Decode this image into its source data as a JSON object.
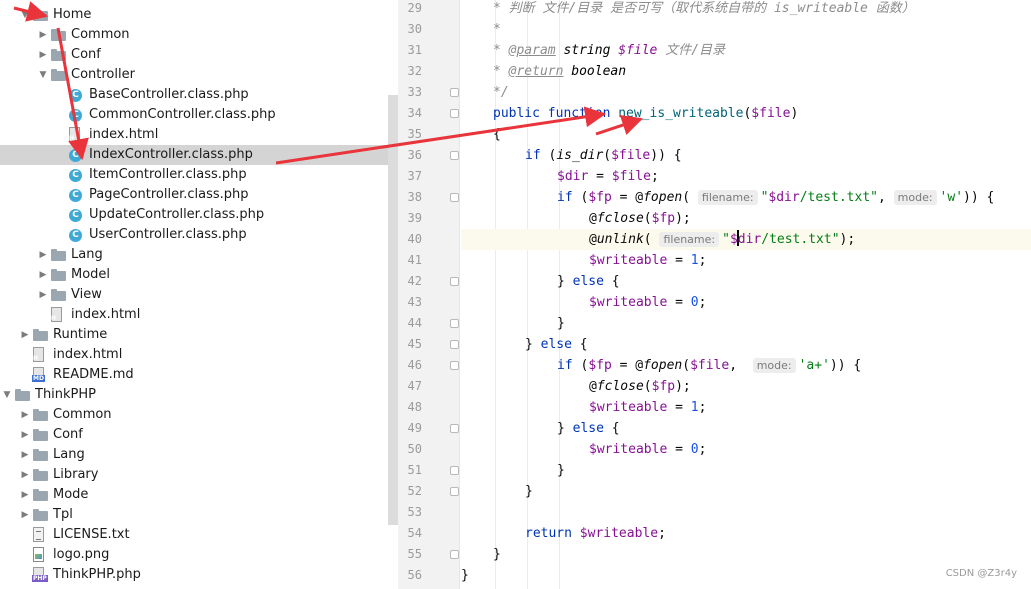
{
  "project_tree": {
    "rows": [
      {
        "label": "Home",
        "depth": 2,
        "arrow": "open",
        "icon": "folder"
      },
      {
        "label": "Common",
        "depth": 3,
        "arrow": "closed",
        "icon": "folder"
      },
      {
        "label": "Conf",
        "depth": 3,
        "arrow": "closed",
        "icon": "folder"
      },
      {
        "label": "Controller",
        "depth": 3,
        "arrow": "open",
        "icon": "folder"
      },
      {
        "label": "BaseController.class.php",
        "depth": 4,
        "arrow": "none",
        "icon": "class"
      },
      {
        "label": "CommonController.class.php",
        "depth": 4,
        "arrow": "none",
        "icon": "class"
      },
      {
        "label": "index.html",
        "depth": 4,
        "arrow": "none",
        "icon": "html"
      },
      {
        "label": "IndexController.class.php",
        "depth": 4,
        "arrow": "none",
        "icon": "class",
        "selected": true
      },
      {
        "label": "ItemController.class.php",
        "depth": 4,
        "arrow": "none",
        "icon": "class"
      },
      {
        "label": "PageController.class.php",
        "depth": 4,
        "arrow": "none",
        "icon": "class"
      },
      {
        "label": "UpdateController.class.php",
        "depth": 4,
        "arrow": "none",
        "icon": "class"
      },
      {
        "label": "UserController.class.php",
        "depth": 4,
        "arrow": "none",
        "icon": "class"
      },
      {
        "label": "Lang",
        "depth": 3,
        "arrow": "closed",
        "icon": "folder"
      },
      {
        "label": "Model",
        "depth": 3,
        "arrow": "closed",
        "icon": "folder"
      },
      {
        "label": "View",
        "depth": 3,
        "arrow": "closed",
        "icon": "folder"
      },
      {
        "label": "index.html",
        "depth": 3,
        "arrow": "none",
        "icon": "html"
      },
      {
        "label": "Runtime",
        "depth": 2,
        "arrow": "closed",
        "icon": "folder"
      },
      {
        "label": "index.html",
        "depth": 2,
        "arrow": "none",
        "icon": "html"
      },
      {
        "label": "README.md",
        "depth": 2,
        "arrow": "none",
        "icon": "md"
      },
      {
        "label": "ThinkPHP",
        "depth": 1,
        "arrow": "open",
        "icon": "folder"
      },
      {
        "label": "Common",
        "depth": 2,
        "arrow": "closed",
        "icon": "folder"
      },
      {
        "label": "Conf",
        "depth": 2,
        "arrow": "closed",
        "icon": "folder"
      },
      {
        "label": "Lang",
        "depth": 2,
        "arrow": "closed",
        "icon": "folder"
      },
      {
        "label": "Library",
        "depth": 2,
        "arrow": "closed",
        "icon": "folder"
      },
      {
        "label": "Mode",
        "depth": 2,
        "arrow": "closed",
        "icon": "folder"
      },
      {
        "label": "Tpl",
        "depth": 2,
        "arrow": "closed",
        "icon": "folder"
      },
      {
        "label": "LICENSE.txt",
        "depth": 2,
        "arrow": "none",
        "icon": "txt"
      },
      {
        "label": "logo.png",
        "depth": 2,
        "arrow": "none",
        "icon": "png"
      },
      {
        "label": "ThinkPHP.php",
        "depth": 2,
        "arrow": "none",
        "icon": "php"
      }
    ]
  },
  "icon_tags": {
    "html": "H",
    "md": "MD",
    "php": "PHP"
  },
  "editor": {
    "current_line": 40,
    "lines": [
      {
        "n": "29",
        "indent": 1,
        "tokens": [
          [
            "cm",
            "* 判断 文件/目录 是否可写（取代系统自带的 is_writeable 函数）"
          ]
        ]
      },
      {
        "n": "30",
        "indent": 1,
        "tokens": [
          [
            "cm",
            "*"
          ]
        ]
      },
      {
        "n": "31",
        "indent": 1,
        "tokens": [
          [
            "cm",
            "* "
          ],
          [
            "tag",
            "@param"
          ],
          [
            "cm",
            " "
          ],
          [
            "dty",
            "string"
          ],
          [
            "cm",
            " "
          ],
          [
            "dvar",
            "$file"
          ],
          [
            "cm",
            " 文件/目录"
          ]
        ]
      },
      {
        "n": "32",
        "indent": 1,
        "tokens": [
          [
            "cm",
            "* "
          ],
          [
            "tag",
            "@return"
          ],
          [
            "cm",
            " "
          ],
          [
            "dty",
            "boolean"
          ]
        ]
      },
      {
        "n": "33",
        "indent": 1,
        "tokens": [
          [
            "cm",
            "*/"
          ]
        ]
      },
      {
        "n": "34",
        "indent": 1,
        "tokens": [
          [
            "kw",
            "public function "
          ],
          [
            "fn",
            "new_is_writeable"
          ],
          [
            "p",
            "("
          ],
          [
            "var",
            "$file"
          ],
          [
            "p",
            ")"
          ]
        ]
      },
      {
        "n": "35",
        "indent": 1,
        "tokens": [
          [
            "p",
            "{"
          ]
        ]
      },
      {
        "n": "36",
        "indent": 2,
        "tokens": [
          [
            "kw",
            "if "
          ],
          [
            "p",
            "("
          ],
          [
            "ifn",
            "is_dir"
          ],
          [
            "p",
            "("
          ],
          [
            "var",
            "$file"
          ],
          [
            "p",
            ")) {"
          ]
        ]
      },
      {
        "n": "37",
        "indent": 3,
        "tokens": [
          [
            "var",
            "$dir"
          ],
          [
            "p",
            " = "
          ],
          [
            "var",
            "$file"
          ],
          [
            "p",
            ";"
          ]
        ]
      },
      {
        "n": "38",
        "indent": 3,
        "tokens": [
          [
            "kw",
            "if "
          ],
          [
            "p",
            "("
          ],
          [
            "var",
            "$fp"
          ],
          [
            "p",
            " = @"
          ],
          [
            "ifn",
            "fopen"
          ],
          [
            "p",
            "( "
          ],
          [
            "hint",
            "filename:"
          ],
          [
            "str",
            "\""
          ],
          [
            "var",
            "$dir"
          ],
          [
            "str",
            "/test.txt\""
          ],
          [
            "p",
            ", "
          ],
          [
            "hint",
            "mode:"
          ],
          [
            "str",
            "'w'"
          ],
          [
            "p",
            ")) {"
          ]
        ]
      },
      {
        "n": "39",
        "indent": 4,
        "tokens": [
          [
            "p",
            "@"
          ],
          [
            "ifn",
            "fclose"
          ],
          [
            "p",
            "("
          ],
          [
            "var",
            "$fp"
          ],
          [
            "p",
            ");"
          ]
        ]
      },
      {
        "n": "40",
        "indent": 4,
        "tokens": [
          [
            "p",
            "@"
          ],
          [
            "ifn",
            "unlink"
          ],
          [
            "p",
            "( "
          ],
          [
            "hint",
            "filename:"
          ],
          [
            "str",
            "\""
          ],
          [
            "var",
            "$"
          ],
          [
            "caret",
            ""
          ],
          [
            "var",
            "dir"
          ],
          [
            "str",
            "/test.txt\""
          ],
          [
            "p",
            ");"
          ]
        ]
      },
      {
        "n": "41",
        "indent": 4,
        "tokens": [
          [
            "var",
            "$writeable"
          ],
          [
            "p",
            " = "
          ],
          [
            "num",
            "1"
          ],
          [
            "p",
            ";"
          ]
        ]
      },
      {
        "n": "42",
        "indent": 3,
        "tokens": [
          [
            "p",
            "} "
          ],
          [
            "kw",
            "else"
          ],
          [
            "p",
            " {"
          ]
        ]
      },
      {
        "n": "43",
        "indent": 4,
        "tokens": [
          [
            "var",
            "$writeable"
          ],
          [
            "p",
            " = "
          ],
          [
            "num",
            "0"
          ],
          [
            "p",
            ";"
          ]
        ]
      },
      {
        "n": "44",
        "indent": 3,
        "tokens": [
          [
            "p",
            "}"
          ]
        ]
      },
      {
        "n": "45",
        "indent": 2,
        "tokens": [
          [
            "p",
            "} "
          ],
          [
            "kw",
            "else"
          ],
          [
            "p",
            " {"
          ]
        ]
      },
      {
        "n": "46",
        "indent": 3,
        "tokens": [
          [
            "kw",
            "if "
          ],
          [
            "p",
            "("
          ],
          [
            "var",
            "$fp"
          ],
          [
            "p",
            " = @"
          ],
          [
            "ifn",
            "fopen"
          ],
          [
            "p",
            "("
          ],
          [
            "var",
            "$file"
          ],
          [
            "p",
            ",  "
          ],
          [
            "hint",
            "mode:"
          ],
          [
            "str",
            "'a+'"
          ],
          [
            "p",
            ")) {"
          ]
        ]
      },
      {
        "n": "47",
        "indent": 4,
        "tokens": [
          [
            "p",
            "@"
          ],
          [
            "ifn",
            "fclose"
          ],
          [
            "p",
            "("
          ],
          [
            "var",
            "$fp"
          ],
          [
            "p",
            ");"
          ]
        ]
      },
      {
        "n": "48",
        "indent": 4,
        "tokens": [
          [
            "var",
            "$writeable"
          ],
          [
            "p",
            " = "
          ],
          [
            "num",
            "1"
          ],
          [
            "p",
            ";"
          ]
        ]
      },
      {
        "n": "49",
        "indent": 3,
        "tokens": [
          [
            "p",
            "} "
          ],
          [
            "kw",
            "else"
          ],
          [
            "p",
            " {"
          ]
        ]
      },
      {
        "n": "50",
        "indent": 4,
        "tokens": [
          [
            "var",
            "$writeable"
          ],
          [
            "p",
            " = "
          ],
          [
            "num",
            "0"
          ],
          [
            "p",
            ";"
          ]
        ]
      },
      {
        "n": "51",
        "indent": 3,
        "tokens": [
          [
            "p",
            "}"
          ]
        ]
      },
      {
        "n": "52",
        "indent": 2,
        "tokens": [
          [
            "p",
            "}"
          ]
        ]
      },
      {
        "n": "53",
        "indent": 0,
        "tokens": []
      },
      {
        "n": "54",
        "indent": 2,
        "tokens": [
          [
            "kw",
            "return "
          ],
          [
            "var",
            "$writeable"
          ],
          [
            "p",
            ";"
          ]
        ]
      },
      {
        "n": "55",
        "indent": 1,
        "tokens": [
          [
            "p",
            "}"
          ]
        ]
      },
      {
        "n": "56",
        "indent": 0,
        "tokens": [
          [
            "p",
            "}"
          ]
        ]
      }
    ]
  },
  "watermark": "CSDN @Z3r4y",
  "annotation_color": "#e8343a"
}
